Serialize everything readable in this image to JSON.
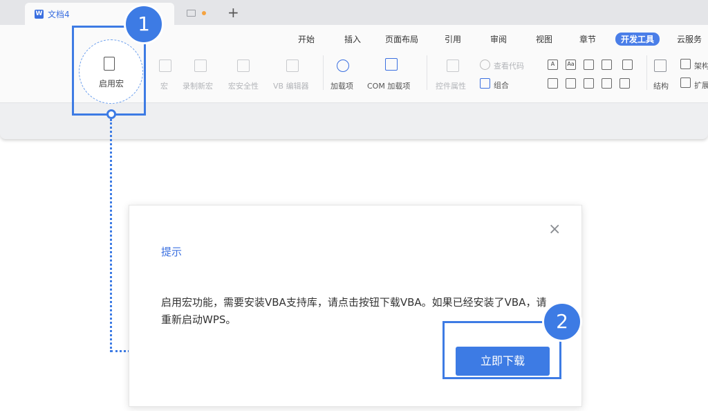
{
  "tab": {
    "title": "文档4",
    "doc_icon_letter": "W"
  },
  "tab_add": "+",
  "menu": [
    "开始",
    "插入",
    "页面布局",
    "引用",
    "审阅",
    "视图",
    "章节",
    "开发工具",
    "云服务"
  ],
  "active_menu": "开发工具",
  "ribbon": {
    "enable_macro": "启用宏",
    "macro": "宏",
    "record_macro": "录制新宏",
    "macro_security": "宏安全性",
    "vb_editor": "VB 编辑器",
    "addins": "加载项",
    "com_addins": "COM 加载项",
    "control_props": "控件属性",
    "view_code": "查看代码",
    "group": "组合",
    "structure": "结构",
    "frame_cut": "架构",
    "expand_cut": "扩展"
  },
  "annotations": {
    "step1": "1",
    "step2": "2",
    "accent_color": "#3d7be4"
  },
  "dialog": {
    "title": "提示",
    "close_symbol": "×",
    "message": "启用宏功能，需要安装VBA支持库，请点击按钮下载VBA。如果已经安装了VBA，请重新启动WPS。",
    "button": "立即下载"
  }
}
